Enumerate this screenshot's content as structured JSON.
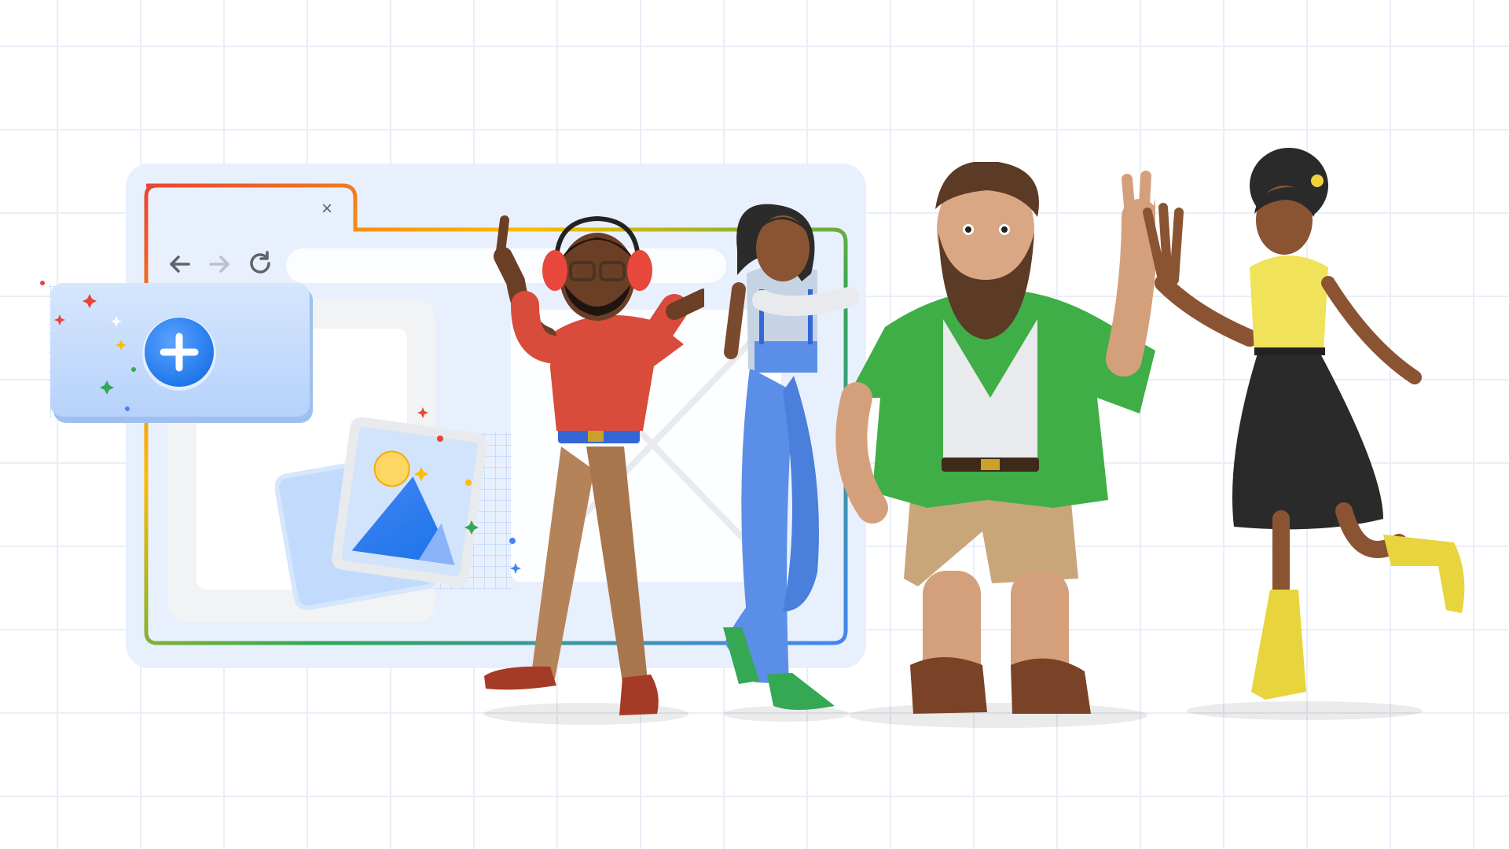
{
  "browser": {
    "close_glyph": "×",
    "nav_icons": [
      "back-arrow-icon",
      "forward-arrow-icon",
      "reload-icon"
    ]
  },
  "cards": {
    "add_icon": "plus-icon",
    "image_icon": "image-icon"
  },
  "figures": [
    "person-with-headphones",
    "woman-in-overalls",
    "bearded-man-green-shirt",
    "woman-high-five"
  ],
  "colors": {
    "google_red": "#ea4335",
    "google_yellow": "#fbbc04",
    "google_green": "#34a853",
    "google_blue": "#4285f4",
    "panel_bg": "#e8f0fe",
    "card_blue": "#c2dbfc",
    "button_blue": "#1a73e8"
  }
}
